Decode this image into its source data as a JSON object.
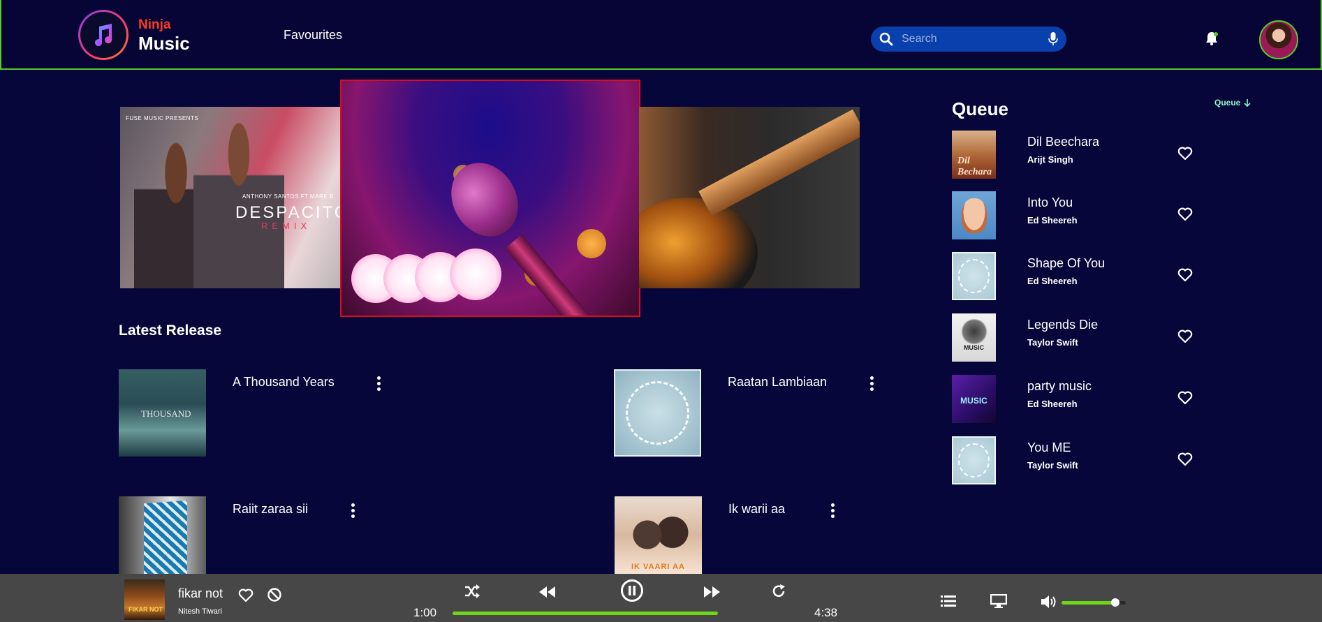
{
  "app": {
    "brand_top": "Ninja",
    "brand_bottom": "Music"
  },
  "header": {
    "nav_favourites": "Favourites",
    "search_placeholder": "Search"
  },
  "carousel": {
    "left": {
      "presents": "FUSE MUSIC PRESENTS",
      "artists": "ANTHONY SANTOS FT MARK B",
      "title": "DESPACITO",
      "subtitle": "REMIX"
    }
  },
  "latest": {
    "title": "Latest Release",
    "tracks": [
      {
        "name": "A Thousand Years",
        "cover_text": "THOUSAND"
      },
      {
        "name": "Raatan Lambiaan"
      },
      {
        "name": "Raiit zaraa sii"
      },
      {
        "name": "Ik warii aa",
        "cover_text": "IK VAARI AA"
      }
    ]
  },
  "queue": {
    "title": "Queue",
    "toggle_label": "Queue",
    "items": [
      {
        "title": "Dil Beechara",
        "artist": "Arijt Singh",
        "cover_text": "Dil Bechara"
      },
      {
        "title": "Into You",
        "artist": "Ed Sheereh"
      },
      {
        "title": "Shape Of You",
        "artist": "Ed Sheereh"
      },
      {
        "title": "Legends Die",
        "artist": "Taylor Swift",
        "cover_text": "MUSIC"
      },
      {
        "title": "party music",
        "artist": "Ed Sheereh",
        "cover_text": "MUSIC"
      },
      {
        "title": "You ME",
        "artist": "Taylor Swift"
      }
    ]
  },
  "player": {
    "title": "fikar not",
    "artist": "Nitesh Tiwari",
    "cover_text": "FIKAR NOT",
    "time_current": "1:00",
    "time_total": "4:38",
    "progress_fraction": 1.0,
    "volume_fraction": 0.84
  },
  "colors": {
    "background": "#07063a",
    "accent_green": "#6fd61c",
    "header_border": "#55cc2a",
    "search_bg": "#0a3fae",
    "player_bg": "#474747",
    "brand_red": "#ff3a24",
    "queue_toggle": "#8ff7c8"
  },
  "icons": {
    "logo": "music-note-icon",
    "search": "search-icon",
    "mic": "microphone-icon",
    "bell": "bell-icon",
    "menu": "kebab-menu-icon",
    "heart": "heart-icon",
    "block": "block-icon",
    "shuffle": "shuffle-icon",
    "previous": "rewind-icon",
    "pause": "pause-icon",
    "next": "fast-forward-icon",
    "repeat": "repeat-icon",
    "queue": "list-icon",
    "device": "monitor-icon",
    "volume": "volume-icon"
  }
}
